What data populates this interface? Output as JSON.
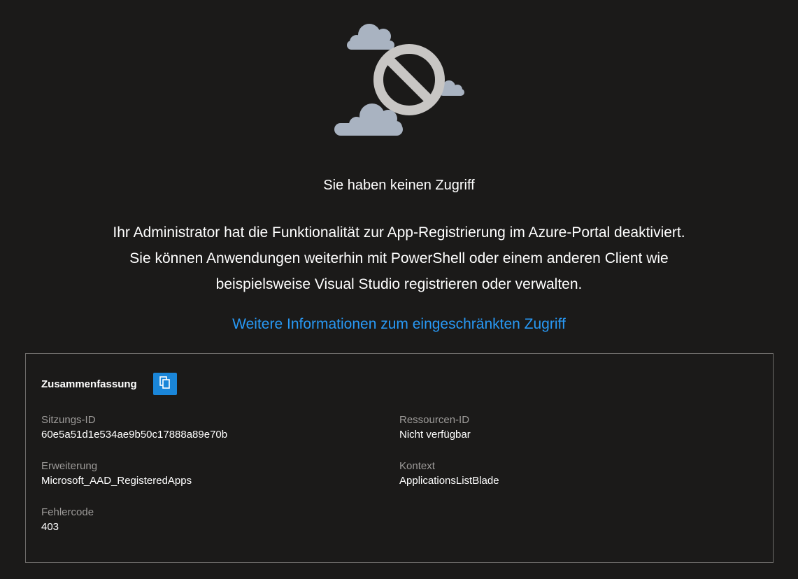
{
  "error": {
    "title": "Sie haben keinen Zugriff",
    "message_lines": [
      "Ihr Administrator hat die Funktionalität zur App-Registrierung im Azure-Portal deaktiviert.",
      "Sie können Anwendungen weiterhin mit PowerShell oder einem anderen Client wie",
      "beispielsweise Visual Studio registrieren oder verwalten."
    ],
    "link_text": "Weitere Informationen zum eingeschränkten Zugriff",
    "illustration_icon": "no-access-cloud-icon"
  },
  "summary": {
    "heading": "Zusammenfassung",
    "copy_icon": "copy-icon",
    "fields": {
      "session_id": {
        "label": "Sitzungs-ID",
        "value": "60e5a51d1e534ae9b50c17888a89e70b"
      },
      "resource_id": {
        "label": "Ressourcen-ID",
        "value": "Nicht verfügbar"
      },
      "extension": {
        "label": "Erweiterung",
        "value": "Microsoft_AAD_RegisteredApps"
      },
      "context": {
        "label": "Kontext",
        "value": "ApplicationsListBlade"
      },
      "error_code": {
        "label": "Fehlercode",
        "value": "403"
      }
    }
  },
  "colors": {
    "background": "#1b1a19",
    "link": "#2899f5",
    "copy_button": "#1a86d9",
    "label_text": "#9d9b99",
    "border": "#6e6c6a"
  }
}
